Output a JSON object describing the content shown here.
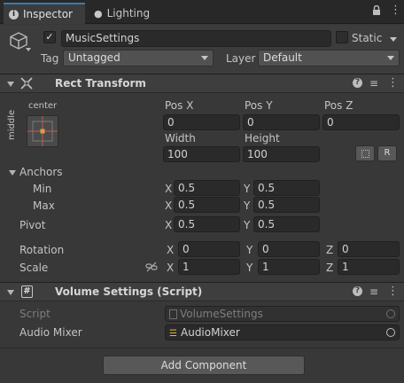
{
  "tabs": [
    {
      "label": "Inspector",
      "icon": "info-icon"
    },
    {
      "label": "Lighting",
      "icon": "bulb-icon"
    }
  ],
  "gameobject": {
    "active": true,
    "name": "MusicSettings",
    "static_label": "Static",
    "tag_label": "Tag",
    "tag_value": "Untagged",
    "layer_label": "Layer",
    "layer_value": "Default"
  },
  "rect_transform": {
    "title": "Rect Transform",
    "anchor_preset_h": "center",
    "anchor_preset_v": "middle",
    "pos_x_label": "Pos X",
    "pos_x": "0",
    "pos_y_label": "Pos Y",
    "pos_y": "0",
    "pos_z_label": "Pos Z",
    "pos_z": "0",
    "width_label": "Width",
    "width": "100",
    "height_label": "Height",
    "height": "100",
    "raw_label": "R",
    "anchors_label": "Anchors",
    "min_label": "Min",
    "min_x": "0.5",
    "min_y": "0.5",
    "max_label": "Max",
    "max_x": "0.5",
    "max_y": "0.5",
    "pivot_label": "Pivot",
    "pivot_x": "0.5",
    "pivot_y": "0.5",
    "rotation_label": "Rotation",
    "rot_x": "0",
    "rot_y": "0",
    "rot_z": "0",
    "scale_label": "Scale",
    "scale_x": "1",
    "scale_y": "1",
    "scale_z": "1",
    "axis_x": "X",
    "axis_y": "Y",
    "axis_z": "Z"
  },
  "volume_settings": {
    "title": "Volume Settings (Script)",
    "script_label": "Script",
    "script_value": "VolumeSettings",
    "mixer_label": "Audio Mixer",
    "mixer_value": "AudioMixer"
  },
  "add_component_label": "Add Component"
}
